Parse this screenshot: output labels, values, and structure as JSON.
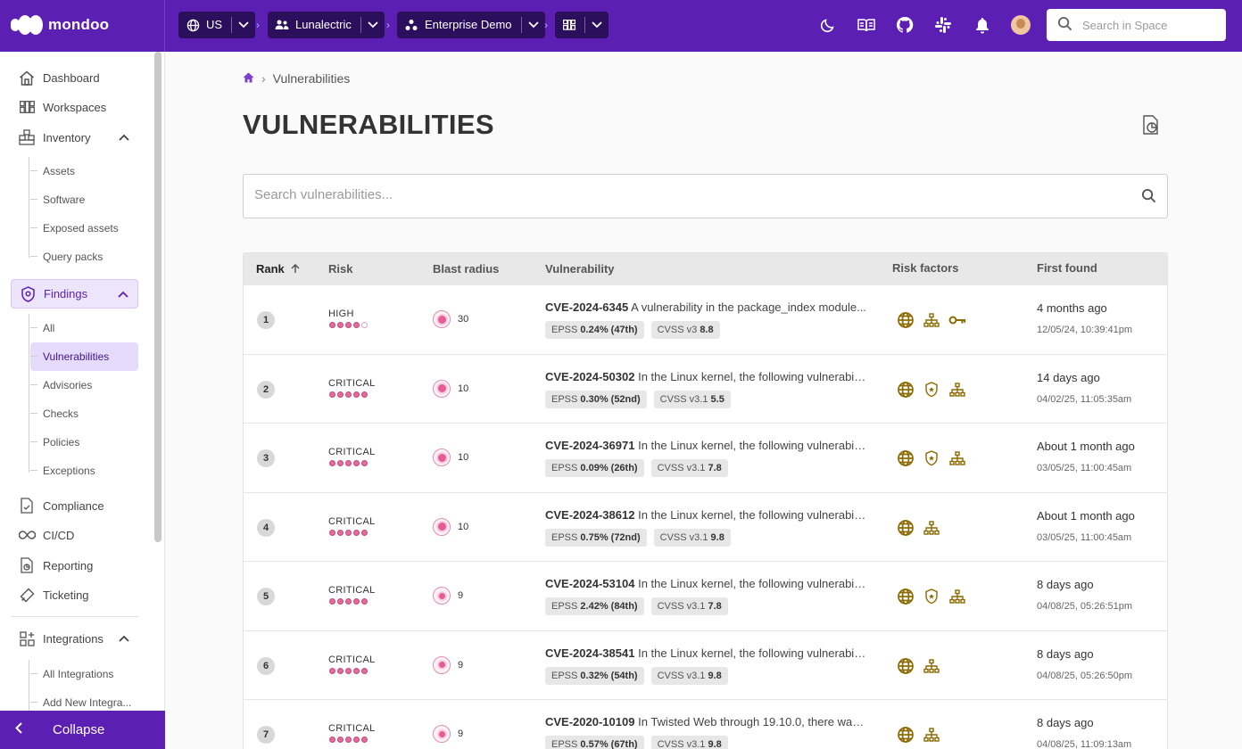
{
  "app": {
    "name": "mondoo"
  },
  "topbar": {
    "region": "US",
    "organization": "Lunalectric",
    "space": "Enterprise Demo",
    "search_placeholder": "Search in Space",
    "icons": [
      "moon-icon",
      "book-icon",
      "github-icon",
      "slack-icon",
      "bell-icon"
    ]
  },
  "sidebar": {
    "dashboard": "Dashboard",
    "workspaces": "Workspaces",
    "inventory": "Inventory",
    "inventory_items": [
      "Assets",
      "Software",
      "Exposed assets",
      "Query packs"
    ],
    "findings": "Findings",
    "findings_items": [
      "All",
      "Vulnerabilities",
      "Advisories",
      "Checks",
      "Policies",
      "Exceptions"
    ],
    "compliance": "Compliance",
    "cicd": "CI/CD",
    "reporting": "Reporting",
    "ticketing": "Ticketing",
    "integrations": "Integrations",
    "integrations_items": [
      "All Integrations",
      "Add New Integra..."
    ],
    "collapse": "Collapse"
  },
  "breadcrumb": {
    "current": "Vulnerabilities"
  },
  "page": {
    "title": "VULNERABILITIES",
    "search_placeholder": "Search vulnerabilities..."
  },
  "table": {
    "columns": {
      "rank": "Rank",
      "risk": "Risk",
      "blast": "Blast radius",
      "vulnerability": "Vulnerability",
      "risk_factors": "Risk factors",
      "first_found": "First found"
    },
    "rows": [
      {
        "rank": "1",
        "risk": "HIGH",
        "risk_level": 4,
        "blast": "30",
        "cve": "CVE-2024-6345",
        "desc": "A vulnerability in the package_index module...",
        "epss": "0.24% (47th)",
        "cvss_label": "CVSS v3",
        "cvss": "8.8",
        "factors": [
          "globe-icon",
          "network-icon",
          "key-icon"
        ],
        "rel": "4 months ago",
        "abs": "12/05/24, 10:39:41pm"
      },
      {
        "rank": "2",
        "risk": "CRITICAL",
        "risk_level": 5,
        "blast": "10",
        "cve": "CVE-2024-50302",
        "desc": "In the Linux kernel, the following vulnerabili...",
        "epss": "0.30% (52nd)",
        "cvss_label": "CVSS v3.1",
        "cvss": "5.5",
        "factors": [
          "globe-icon",
          "shield-icon",
          "network-icon"
        ],
        "rel": "14 days ago",
        "abs": "04/02/25, 11:05:35am"
      },
      {
        "rank": "3",
        "risk": "CRITICAL",
        "risk_level": 5,
        "blast": "10",
        "cve": "CVE-2024-36971",
        "desc": "In the Linux kernel, the following vulnerabili...",
        "epss": "0.09% (26th)",
        "cvss_label": "CVSS v3.1",
        "cvss": "7.8",
        "factors": [
          "globe-icon",
          "shield-icon",
          "network-icon"
        ],
        "rel": "About 1 month ago",
        "abs": "03/05/25, 11:00:45am"
      },
      {
        "rank": "4",
        "risk": "CRITICAL",
        "risk_level": 5,
        "blast": "10",
        "cve": "CVE-2024-38612",
        "desc": "In the Linux kernel, the following vulnerabili...",
        "epss": "0.75% (72nd)",
        "cvss_label": "CVSS v3.1",
        "cvss": "9.8",
        "factors": [
          "globe-icon",
          "network-icon"
        ],
        "rel": "About 1 month ago",
        "abs": "03/05/25, 11:00:45am"
      },
      {
        "rank": "5",
        "risk": "CRITICAL",
        "risk_level": 5,
        "blast": "9",
        "cve": "CVE-2024-53104",
        "desc": "In the Linux kernel, the following vulnerabili...",
        "epss": "2.42% (84th)",
        "cvss_label": "CVSS v3.1",
        "cvss": "7.8",
        "factors": [
          "globe-icon",
          "shield-icon",
          "network-icon"
        ],
        "rel": "8 days ago",
        "abs": "04/08/25, 05:26:51pm"
      },
      {
        "rank": "6",
        "risk": "CRITICAL",
        "risk_level": 5,
        "blast": "9",
        "cve": "CVE-2024-38541",
        "desc": "In the Linux kernel, the following vulnerabili...",
        "epss": "0.32% (54th)",
        "cvss_label": "CVSS v3.1",
        "cvss": "9.8",
        "factors": [
          "globe-icon",
          "network-icon"
        ],
        "rel": "8 days ago",
        "abs": "04/08/25, 05:26:50pm"
      },
      {
        "rank": "7",
        "risk": "CRITICAL",
        "risk_level": 5,
        "blast": "9",
        "cve": "CVE-2020-10109",
        "desc": "In Twisted Web through 19.10.0, there was...",
        "epss": "0.57% (67th)",
        "cvss_label": "CVSS v3.1",
        "cvss": "9.8",
        "factors": [
          "globe-icon",
          "network-icon"
        ],
        "rel": "8 days ago",
        "abs": "04/08/25, 11:09:13am"
      }
    ]
  },
  "colors": {
    "brand": "#5b1fb3",
    "risk": "#e46b9a",
    "factor": "#8a6a00"
  }
}
